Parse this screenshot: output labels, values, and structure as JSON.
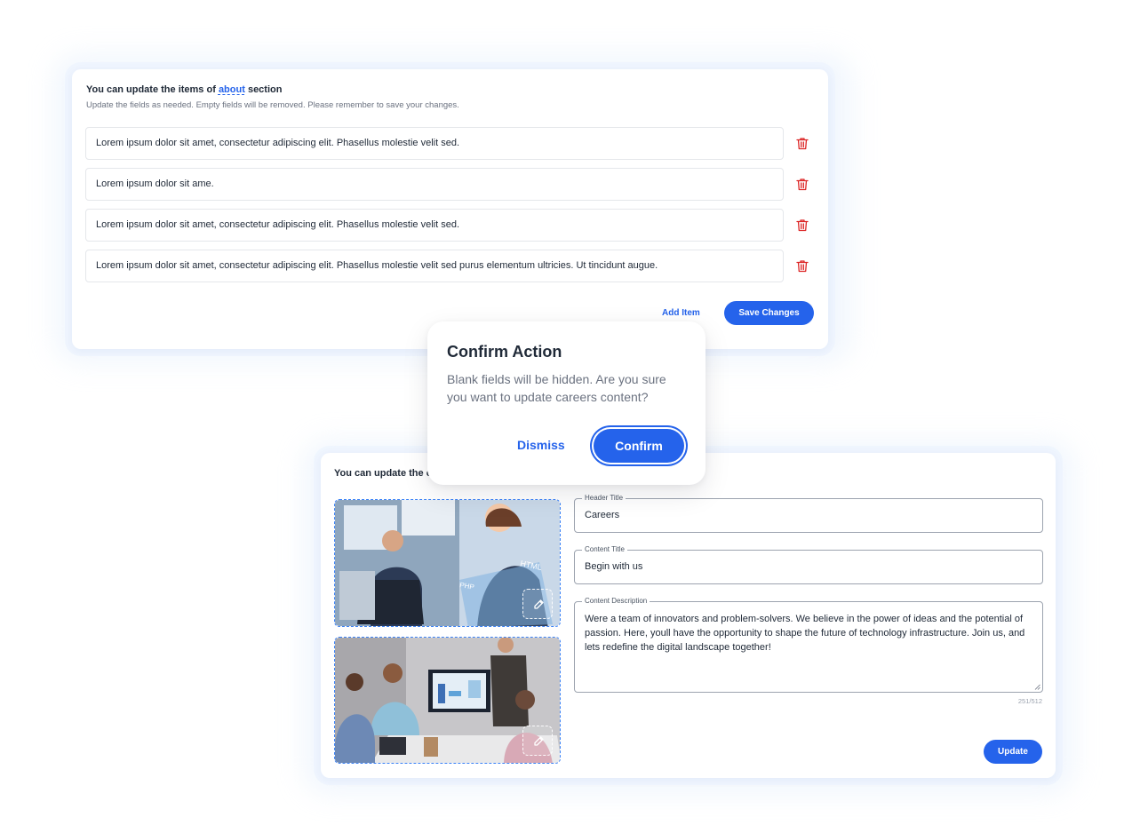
{
  "about_card": {
    "title_prefix": "You can update the items of ",
    "title_link": "about",
    "title_suffix": " section",
    "subtitle": "Update the fields as needed. Empty fields will be removed. Please remember to save your changes.",
    "items": [
      "Lorem ipsum dolor sit amet, consectetur adipiscing elit. Phasellus molestie velit sed.",
      "Lorem ipsum dolor sit ame.",
      "Lorem ipsum dolor sit amet, consectetur adipiscing elit. Phasellus molestie velit sed.",
      "Lorem ipsum dolor sit amet, consectetur adipiscing elit. Phasellus molestie velit sed purus elementum ultricies. Ut tincidunt augue."
    ],
    "add_item_label": "Add Item",
    "save_label": "Save Changes"
  },
  "dialog": {
    "title": "Confirm Action",
    "body": "Blank fields will be hidden. Are you sure you want to update careers content?",
    "dismiss_label": "Dismiss",
    "confirm_label": "Confirm"
  },
  "careers_card": {
    "title": "You can update the c",
    "header_title": {
      "label": "Header Title",
      "value": "Careers"
    },
    "content_title": {
      "label": "Content Title",
      "value": "Begin with us"
    },
    "content_description": {
      "label": "Content Description",
      "value": "Were a team of innovators and problem-solvers. We believe in the power of ideas and the potential of passion. Here, youll have the opportunity to shape the future of technology infrastructure. Join us, and lets redefine the digital landscape together!",
      "counter": "251/512"
    },
    "image_overlay_labels": [
      "HTML",
      "PHP"
    ],
    "update_label": "Update"
  },
  "colors": {
    "accent": "#2563eb",
    "danger": "#dc2626",
    "text": "#1f2937",
    "muted": "#6b7280"
  },
  "icons": [
    "trash-icon",
    "pencil-icon"
  ]
}
